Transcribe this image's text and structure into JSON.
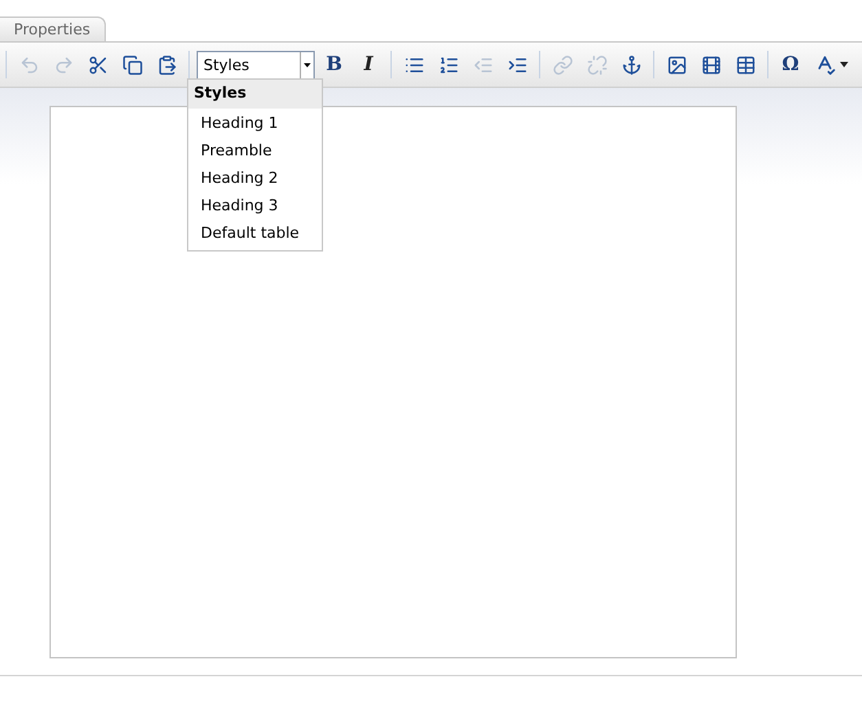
{
  "tabs": [
    {
      "label": "Properties",
      "selected": true
    }
  ],
  "toolbar": {
    "groups": [
      [
        {
          "kind": "icon",
          "disabled": true
        },
        {
          "kind": "icon",
          "disabled": true
        },
        {
          "kind": "icon",
          "disabled": false
        },
        {
          "kind": "icon",
          "disabled": false
        },
        {
          "kind": "icon",
          "disabled": false
        }
      ],
      [
        {
          "kind": "select",
          "value": "Styles",
          "expanded": true
        },
        {
          "kind": "text",
          "label": "B",
          "disabled": false
        },
        {
          "kind": "text",
          "label": "I",
          "disabled": false
        }
      ],
      [
        {
          "kind": "icon",
          "disabled": false
        },
        {
          "kind": "icon",
          "disabled": false
        },
        {
          "kind": "icon",
          "disabled": true
        },
        {
          "kind": "icon",
          "disabled": false
        }
      ],
      [
        {
          "kind": "icon",
          "disabled": true
        },
        {
          "kind": "icon",
          "disabled": true
        },
        {
          "kind": "icon",
          "disabled": false
        }
      ],
      [
        {
          "kind": "icon",
          "disabled": false
        },
        {
          "kind": "icon",
          "disabled": false
        },
        {
          "kind": "icon",
          "disabled": false
        }
      ],
      [
        {
          "kind": "text",
          "label": "Ω",
          "disabled": false
        },
        {
          "kind": "menu",
          "disabled": false
        }
      ]
    ]
  },
  "styles_menu": {
    "title": "Styles",
    "items": [
      "Heading 1",
      "Preamble",
      "Heading 2",
      "Heading 3",
      "Default table"
    ]
  }
}
